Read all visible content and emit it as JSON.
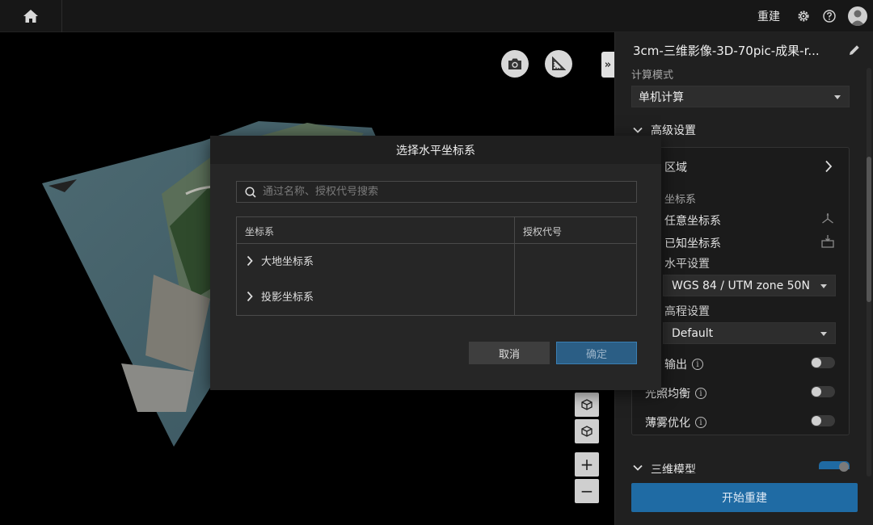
{
  "topbar": {
    "rebuild_label": "重建"
  },
  "panel": {
    "title": "3cm-三维影像-3D-70pic-成果-r...",
    "compute_mode_label": "计算模式",
    "compute_mode_value": "单机计算",
    "advanced_settings_label": "高级设置",
    "region_label": "区域",
    "coord_system_label": "坐标系",
    "any_coord_label": "任意坐标系",
    "known_coord_label": "已知坐标系",
    "horizontal_label": "水平设置",
    "horizontal_value": "WGS 84 / UTM zone 50N",
    "elevation_label": "高程设置",
    "elevation_value": "Default",
    "output_label": "输出",
    "light_balance_label": "光照均衡",
    "haze_label": "薄雾优化",
    "model3d_label": "三维模型",
    "start_label": "开始重建"
  },
  "toggles": {
    "output": false,
    "light_balance": false,
    "haze": false,
    "model3d": true
  },
  "dialog": {
    "title": "选择水平坐标系",
    "search_placeholder": "通过名称、授权代号搜索",
    "col_coord": "坐标系",
    "col_code": "授权代号",
    "rows": [
      {
        "label": "大地坐标系"
      },
      {
        "label": "投影坐标系"
      }
    ],
    "cancel_label": "取消",
    "ok_label": "确定"
  },
  "viewport": {
    "collapse_glyph": "»",
    "zoom_in_glyph": "+",
    "zoom_out_glyph": "−"
  },
  "colors": {
    "accent": "#1f6ba4",
    "panel_bg": "#202020",
    "dialog_bg": "#262626"
  }
}
